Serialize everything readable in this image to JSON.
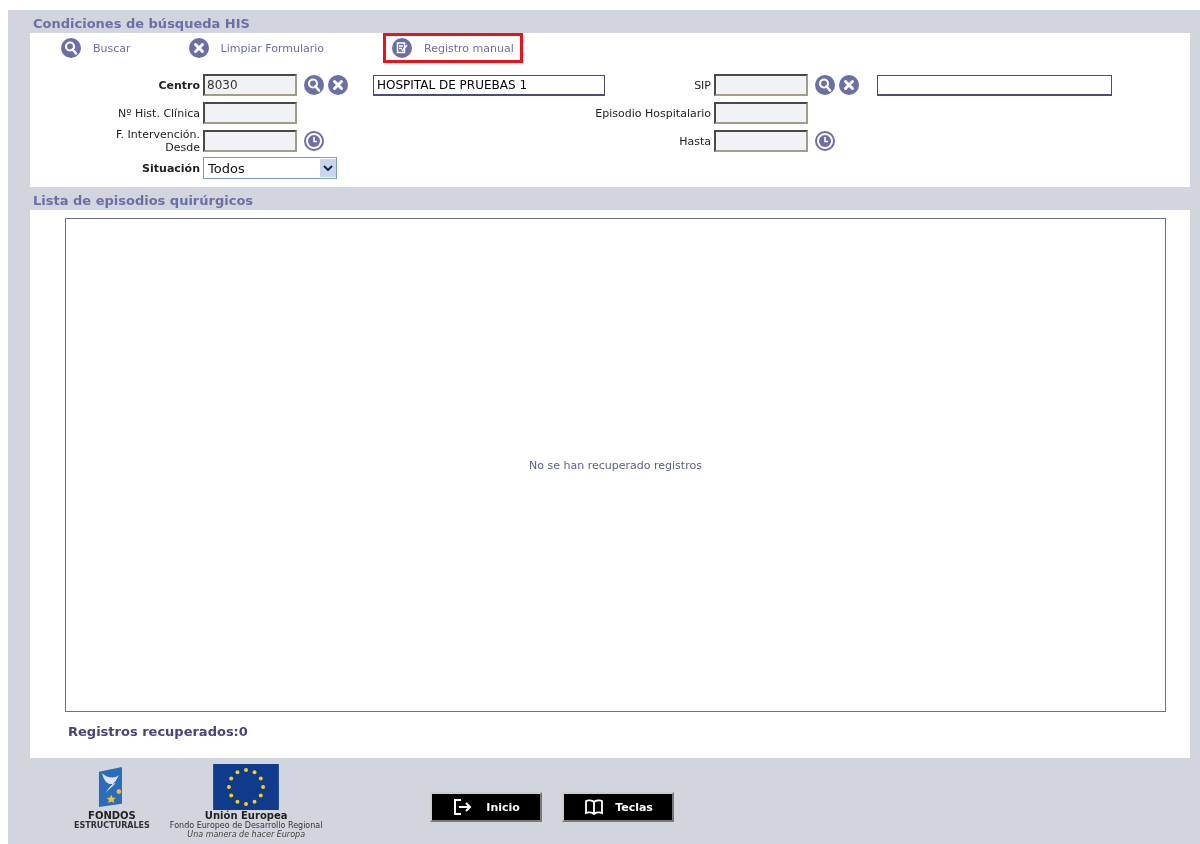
{
  "search_section": {
    "title": "Condiciones de búsqueda HIS",
    "toolbar": [
      {
        "kind": "search",
        "label": "Buscar",
        "highlighted": false
      },
      {
        "kind": "clear",
        "label": "Limpiar Formulario",
        "highlighted": false
      },
      {
        "kind": "edit",
        "label": "Registro manual",
        "highlighted": true
      }
    ],
    "rows": [
      {
        "left": {
          "kind": "lookup",
          "label_lines": [
            "Centro"
          ],
          "bold": true,
          "value": "8030",
          "name_value": "HOSPITAL DE PRUEBAS 1"
        },
        "right": {
          "kind": "lookup",
          "label_lines": [
            "SIP"
          ],
          "bold": false
        }
      },
      {
        "left": {
          "kind": "text",
          "label_lines": [
            "Nº Hist. Clínica"
          ],
          "bold": false
        },
        "right": {
          "kind": "text",
          "label_lines": [
            "Episodio Hospitalario"
          ],
          "bold": false
        }
      },
      {
        "left": {
          "kind": "date",
          "label_lines": [
            "F. Intervención.",
            "Desde"
          ],
          "bold": false
        },
        "right": {
          "kind": "date",
          "label_lines": [
            "Hasta"
          ],
          "bold": false
        }
      },
      {
        "left": {
          "kind": "select",
          "label_lines": [
            "Situación"
          ],
          "bold": true,
          "value": "Todos"
        }
      }
    ]
  },
  "list_section": {
    "title": "Lista de episodios quirúrgicos",
    "empty_message": "No se han recuperado registros",
    "count_label": "Registros recuperados:0"
  },
  "footer": {
    "logos": [
      {
        "kind": "fondos",
        "caption": "FONDOS",
        "subcaption": "ESTRUCTURALES"
      },
      {
        "kind": "eu",
        "caption": "Unión Europea",
        "subcaption": "Fondo Europeo de Desarrollo Regional",
        "motto": "Una manera de hacer Europa"
      }
    ],
    "buttons": [
      {
        "kind": "exit",
        "label": "Inicio"
      },
      {
        "kind": "book",
        "label": "Teclas"
      }
    ]
  }
}
